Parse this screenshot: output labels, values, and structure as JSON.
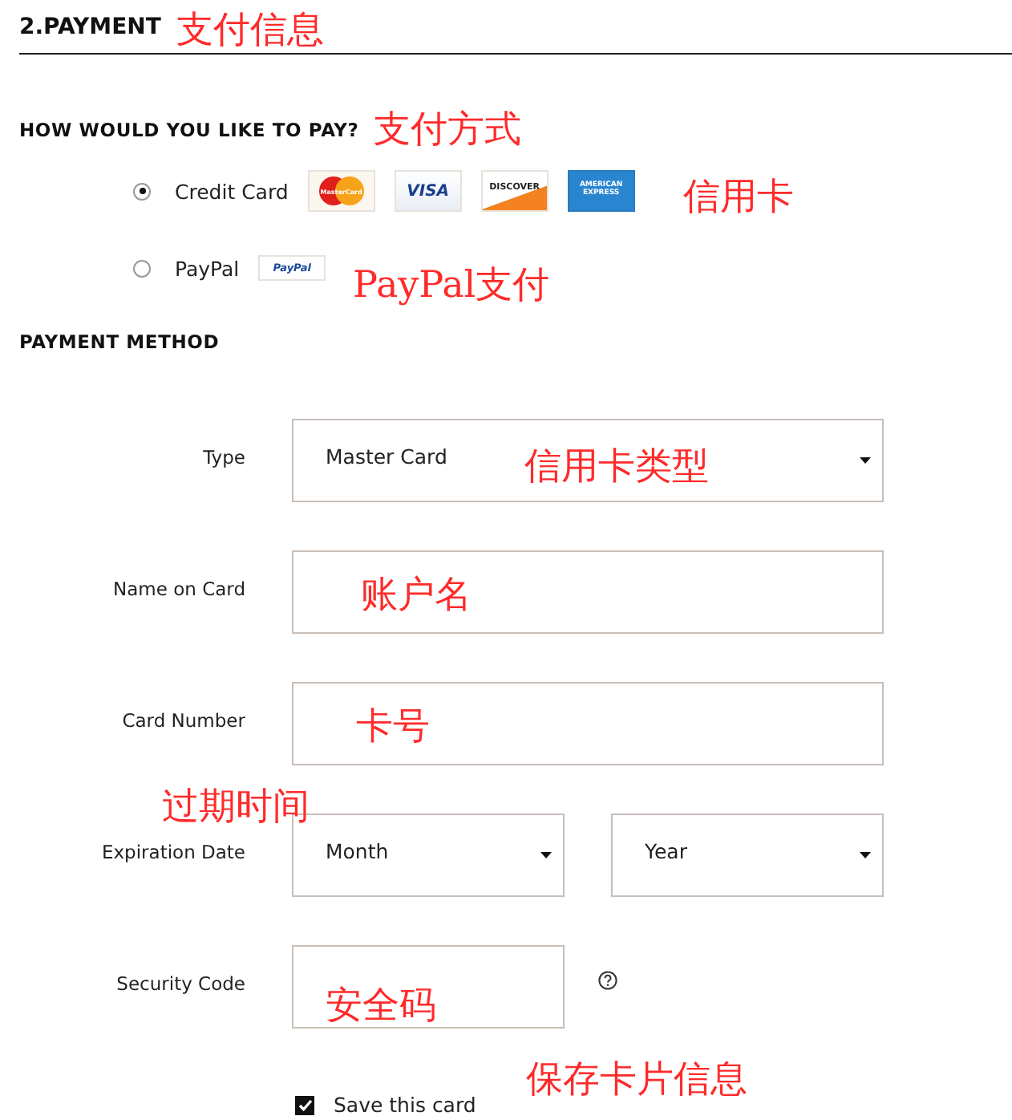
{
  "section_title": "2.PAYMENT",
  "pay_question": "HOW WOULD YOU LIKE TO PAY?",
  "pay_options": [
    {
      "label": "Credit Card",
      "selected": true,
      "logos": [
        {
          "kind": "mastercard",
          "text": "MasterCard"
        },
        {
          "kind": "visa",
          "text": "VISA"
        },
        {
          "kind": "discover",
          "text": "DISCOVER"
        },
        {
          "kind": "amex",
          "text": "AMERICAN EXPRESS"
        }
      ]
    },
    {
      "label": "PayPal",
      "selected": false,
      "logos": [
        {
          "kind": "paypal",
          "text": "PayPal"
        }
      ]
    }
  ],
  "method_title": "PAYMENT METHOD",
  "fields": [
    {
      "label": "Type",
      "kind": "select",
      "values": [
        "Master Card"
      ]
    },
    {
      "label": "Name on Card",
      "kind": "text"
    },
    {
      "label": "Card Number",
      "kind": "text"
    },
    {
      "label": "Expiration Date",
      "kind": "select",
      "values": [
        "Month",
        "Year"
      ]
    },
    {
      "label": "Security Code",
      "kind": "text_help"
    }
  ],
  "save_card": {
    "label": "Save this card",
    "checked": true
  },
  "annotations": [
    "支付信息",
    "支付方式",
    "信用卡",
    "PayPal支付",
    "信用卡类型",
    "账户名",
    "卡号",
    "过期时间",
    "安全码",
    "保存卡片信息"
  ]
}
